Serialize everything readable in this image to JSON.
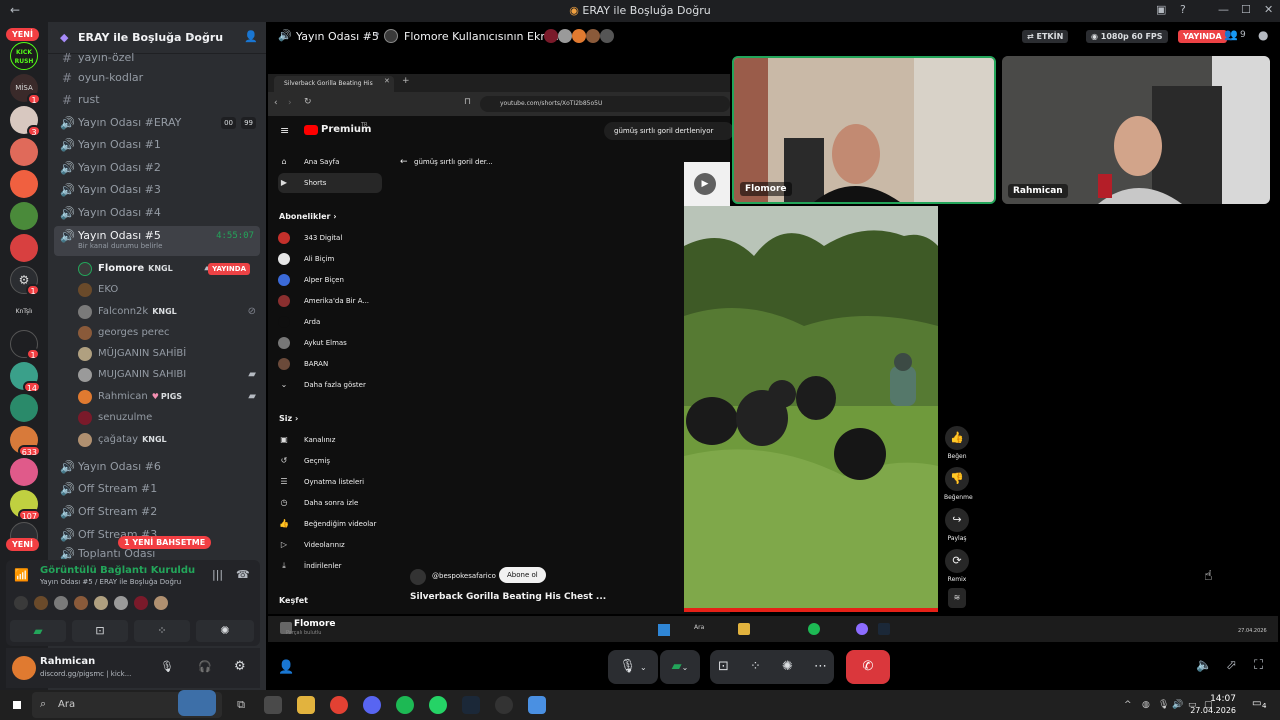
{
  "window": {
    "title": "ERAY ile Boşluğa Doğru"
  },
  "rail": {
    "new_top": "YENİ",
    "new_bottom": "YENİ",
    "kick_label": "KICK RUSH",
    "mi_label": "MİSA",
    "knt_label": "KnTşlı",
    "badges": [
      "1",
      "3",
      "1",
      "1",
      "14",
      "633",
      "107"
    ]
  },
  "server": {
    "name": "ERAY ile Boşluğa Doğru",
    "channels": [
      {
        "name": "yayın-özel",
        "glyph": "#"
      },
      {
        "name": "oyun-kodlar",
        "glyph": "#"
      },
      {
        "name": "rust",
        "glyph": "#"
      },
      {
        "name": "Yayın Odası #ERAY",
        "glyph": "🔊",
        "counts": [
          "00",
          "99"
        ]
      },
      {
        "name": "Yayın Odası #1",
        "glyph": "🔊"
      },
      {
        "name": "Yayın Odası #2",
        "glyph": "🔊"
      },
      {
        "name": "Yayın Odası #3",
        "glyph": "🔊"
      },
      {
        "name": "Yayın Odası #4",
        "glyph": "🔊"
      }
    ],
    "active_channel": {
      "name": "Yayın Odası #5",
      "timer": "4:55:07",
      "status": "Bir kanal durumu belirle"
    },
    "members": [
      {
        "name": "Flomore",
        "tag": "KNGL",
        "live": "YAYINDA"
      },
      {
        "name": "EKO"
      },
      {
        "name": "Falconn2k",
        "tag": "KNGL"
      },
      {
        "name": "georges perec"
      },
      {
        "name": "MÜJGANIN SAHİBİ"
      },
      {
        "name": "MUJGANIN SAHIBI"
      },
      {
        "name": "Rahmican",
        "tag": "PIGS"
      },
      {
        "name": "senuzulme"
      },
      {
        "name": "çağatay",
        "tag": "KNGL"
      }
    ],
    "channels_after": [
      {
        "name": "Yayın Odası #6"
      },
      {
        "name": "Off Stream #1"
      },
      {
        "name": "Off Stream #2"
      },
      {
        "name": "Off Stream #3"
      },
      {
        "name": "Toplantı Odası"
      }
    ],
    "mention_pill": "1 YENİ BAHSETME"
  },
  "voice_panel": {
    "status": "Görüntülü Bağlantı Kuruldu",
    "location": "Yayın Odası #5 / ERAY ile Boşluğa Doğru"
  },
  "user_bar": {
    "name": "Rahmican",
    "status": "discord.gg/pigsmc | kick..."
  },
  "stage_header": {
    "channel": "Yayın Odası #5",
    "screen": "Flomore Kullanıcısının Ekranı",
    "activity": "ETKİN",
    "quality": "1080p 60 FPS",
    "live": "YAYINDA",
    "viewers": "9"
  },
  "browser": {
    "tab_title": "Silverback Gorilla Beating His",
    "url": "youtube.com/shorts/XoTI2b85o5U"
  },
  "youtube": {
    "logo": "Premium",
    "logo_sup": "TR",
    "search_chip": "gümüş sırtlı goril dertleniyor",
    "back_label": "gümüş sırtlı goril der...",
    "nav": [
      {
        "label": "Ana Sayfa",
        "icon": "⌂"
      },
      {
        "label": "Shorts",
        "icon": "▶"
      }
    ],
    "subs_title": "Abonelikler",
    "subs": [
      {
        "label": "343 Digital",
        "color": "#c4302b"
      },
      {
        "label": "Ali Biçim",
        "color": "#e6e6e6"
      },
      {
        "label": "Alper Biçen",
        "color": "#3b6ad8"
      },
      {
        "label": "Amerika'da Bir A...",
        "color": "#8a2f2f"
      },
      {
        "label": "Arda",
        "color": "#0f0f0f"
      },
      {
        "label": "Aykut Elmas",
        "color": "#777"
      },
      {
        "label": "BARAN",
        "color": "#6b4a3a"
      }
    ],
    "show_more": "Daha fazla göster",
    "you_title": "Siz",
    "you_items": [
      "Kanalınız",
      "Geçmiş",
      "Oynatma listeleri",
      "Daha sonra izle",
      "Beğendiğim videolar",
      "Videolarınız",
      "İndirilenler"
    ],
    "explore_title": "Keşfet",
    "channel_handle": "@bespokesafarico",
    "subscribe": "Abone ol",
    "video_title": "Silverback Gorilla Beating His Chest ...",
    "actions": [
      "Beğen",
      "Beğenme",
      "Paylaş",
      "Remix"
    ]
  },
  "inner_taskbar": {
    "app": "Flomore",
    "sub": "Parçalı bulutlu",
    "search": "Ara",
    "date": "27.04.2026"
  },
  "cams": [
    {
      "name": "Flomore"
    },
    {
      "name": "Rahmican"
    }
  ],
  "taskbar": {
    "search": "Ara",
    "time": "14:07",
    "date": "27.04.2026",
    "notif": "4"
  }
}
